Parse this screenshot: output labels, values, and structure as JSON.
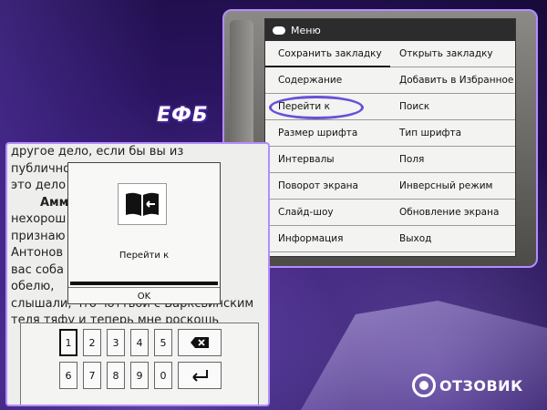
{
  "menu": {
    "title": "Меню",
    "items": [
      {
        "label": "Сохранить закладку"
      },
      {
        "label": "Открыть закладку"
      },
      {
        "label": "Содержание"
      },
      {
        "label": "Добавить в Избранное"
      },
      {
        "label": "Перейти к"
      },
      {
        "label": "Поиск"
      },
      {
        "label": "Размер шрифта"
      },
      {
        "label": "Тип шрифта"
      },
      {
        "label": "Интервалы"
      },
      {
        "label": "Поля"
      },
      {
        "label": "Поворот экрана"
      },
      {
        "label": "Инверсный режим"
      },
      {
        "label": "Слайд-шоу"
      },
      {
        "label": "Обновление экрана"
      },
      {
        "label": "Информация"
      },
      {
        "label": "Выход"
      }
    ]
  },
  "goto_dialog": {
    "label": "Перейти к",
    "ok_label": "OK",
    "icon": "book-goto-icon"
  },
  "keypad": {
    "row1": [
      "1",
      "2",
      "3",
      "4",
      "5"
    ],
    "row2": [
      "6",
      "7",
      "8",
      "9",
      "0"
    ],
    "backspace_icon": "backspace-icon",
    "enter_icon": "enter-icon"
  },
  "page_text": {
    "lines": [
      "другое дело, если бы вы из",
      "публично",
      "это дело",
      "Амм",
      "нехорош",
      "признаю",
      "Антонов",
      "вас соба                        Тому",
      "обелю,                         Ведь вы",
      "слышали, что чоттвой с Барксвинским",
      "теля тяфу  и теперь мне роскошь"
    ]
  },
  "logos": {
    "efb": "ЕФБ",
    "otzovik": "ОТЗОВИК"
  },
  "colors": {
    "accent": "#6a4fd8",
    "menu_header_bg": "#2c2c2c",
    "screen_bg": "#f3f3f1"
  }
}
